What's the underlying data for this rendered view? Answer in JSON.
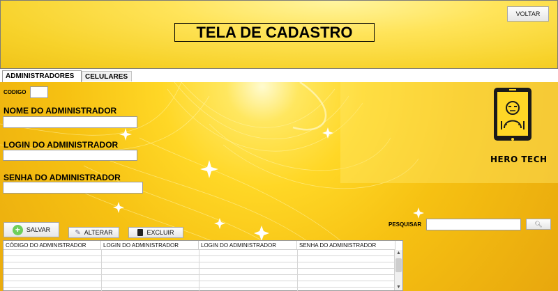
{
  "header": {
    "title": "TELA DE CADASTRO",
    "back_label": "VOLTAR"
  },
  "tabs": [
    {
      "label": "ADMINISTRADORES",
      "active": true
    },
    {
      "label": "CELULARES",
      "active": false
    }
  ],
  "form": {
    "code_label": "CODIGO",
    "name_label": "NOME DO ADMINISTRADOR",
    "login_label": "LOGIN DO ADMINISTRADOR",
    "password_label": "SENHA DO ADMINISTRADOR",
    "code_value": "",
    "name_value": "",
    "login_value": "",
    "password_value": ""
  },
  "actions": {
    "save_label": "SALVAR",
    "edit_label": "ALTERAR",
    "delete_label": "EXCLUIR"
  },
  "search": {
    "label": "PESQUISAR",
    "value": ""
  },
  "brand": {
    "name": "HERO TECH"
  },
  "table": {
    "columns": [
      "CÓDIGO DO ADMINISTRADOR",
      "LOGIN DO ADMINISTRADOR",
      "LOGIN DO ADMINISTRADOR",
      "SENHA DO ADMINISTRADOR"
    ],
    "rows": []
  },
  "colors": {
    "accent": "#f7d22a",
    "panel": "#ffd726"
  },
  "icons": {
    "save": "plus-circle-icon",
    "edit": "pencil-icon",
    "delete": "trash-icon",
    "search": "magnifier-icon",
    "brand": "phone-hero-icon"
  }
}
